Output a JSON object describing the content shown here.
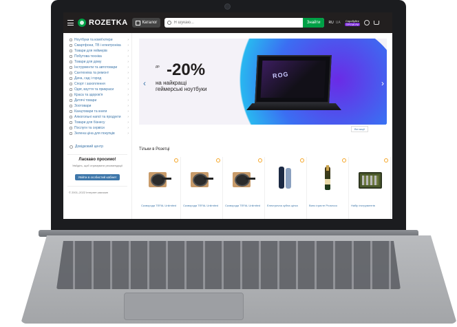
{
  "header": {
    "logo_text": "ROZETKA",
    "catalog_label": "Каталог",
    "search_placeholder": "Я шукаю...",
    "search_button": "Знайти",
    "lang_active": "RU",
    "lang_inactive": "UA",
    "premium_top": "Спробуйте",
    "premium_badge": "ПРЕМІУМ"
  },
  "sidebar": {
    "categories": [
      "Ноутбуки та комп'ютери",
      "Смартфони, ТВ і електроніка",
      "Товари для геймерів",
      "Побутова техніка",
      "Товари для дому",
      "Інструменти та автотовари",
      "Сантехніка та ремонт",
      "Дача, сад і город",
      "Спорт і захоплення",
      "Одяг, взуття та прикраси",
      "Краса та здоров'я",
      "Дитячі товари",
      "Зоотовари",
      "Канцтовари та книги",
      "Алкогольні напої та продукти",
      "Товари для бізнесу",
      "Послуги та сервіси",
      "Зелена ціна для покупців"
    ],
    "help_center": "Довідковий центр",
    "welcome_title": "Ласкаво просимо!",
    "welcome_text": "Увійдіть, щоб отримувати рекомендації",
    "login_button": "Увійти в особистий кабінет",
    "footer_text": "© 2001–2022 Інтернет-магазин"
  },
  "banner": {
    "prefix": "до",
    "discount": "-20%",
    "line1": "на найкращі",
    "line2": "геймерські ноутбуки",
    "screen_text": "ROG",
    "all_promos": "Всі акції"
  },
  "products": {
    "title": "Тільки в Розетці",
    "items": [
      {
        "name": "Сковорода TEFAL Unlimited",
        "type": "pan"
      },
      {
        "name": "Сковорода TEFAL Unlimited",
        "type": "pan"
      },
      {
        "name": "Сковорода TEFAL Unlimited",
        "type": "pan"
      },
      {
        "name": "Електрична зубна щітка",
        "type": "brush"
      },
      {
        "name": "Вино ігристе Prosecco",
        "type": "bottle"
      },
      {
        "name": "Набір інструментів",
        "type": "toolbox"
      }
    ]
  },
  "colors": {
    "header_bg": "#221f1f",
    "accent_green": "#00a046",
    "link_blue": "#3e77aa"
  }
}
